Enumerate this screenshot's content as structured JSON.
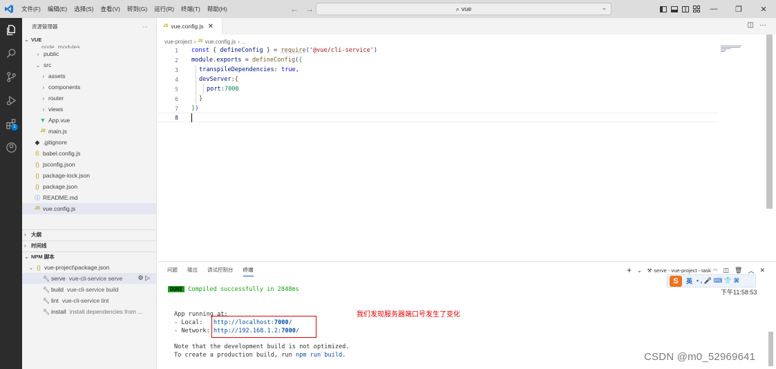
{
  "menu": [
    "文件(F)",
    "编辑(E)",
    "选择(S)",
    "查看(V)",
    "转到(G)",
    "运行(R)",
    "终端(T)",
    "帮助(H)"
  ],
  "command_center": {
    "text": "vue"
  },
  "explorer": {
    "title": "资源管理器",
    "more": "···",
    "root": "VUE",
    "hidden_top": "node_modules",
    "items": [
      {
        "label": "public",
        "icon": "chevron-right"
      },
      {
        "label": "src",
        "icon": "chevron-down"
      },
      {
        "label": "assets",
        "icon": "chevron-right"
      },
      {
        "label": "components",
        "icon": "chevron-right"
      },
      {
        "label": "router",
        "icon": "chevron-right"
      },
      {
        "label": "views",
        "icon": "chevron-right"
      },
      {
        "label": "App.vue",
        "icon": "vue-file"
      },
      {
        "label": "main.js",
        "icon": "js-file"
      },
      {
        "label": ".gitignore",
        "icon": "git-file"
      },
      {
        "label": "babel.config.js",
        "icon": "babel-file"
      },
      {
        "label": "jsconfig.json",
        "icon": "json-file"
      },
      {
        "label": "package-lock.json",
        "icon": "json-file"
      },
      {
        "label": "package.json",
        "icon": "json-file"
      },
      {
        "label": "README.md",
        "icon": "info-file"
      },
      {
        "label": "vue.config.js",
        "icon": "js-file"
      }
    ]
  },
  "sections": {
    "outline": "大纲",
    "timeline": "时间线",
    "npm": "NPM 脚本"
  },
  "npm": {
    "file": "vue-project\\package.json",
    "scripts": [
      {
        "name": "serve",
        "cmd": "vue-cli-service serve"
      },
      {
        "name": "build",
        "cmd": "vue-cli-service build"
      },
      {
        "name": "lint",
        "cmd": "vue-cli-service lint"
      },
      {
        "name": "install",
        "cmd": "install dependencies from ..."
      }
    ]
  },
  "editor": {
    "tab": "vue.config.js",
    "breadcrumb": [
      "vue-project",
      "vue.config.js",
      "..."
    ],
    "line_numbers": [
      "1",
      "2",
      "3",
      "4",
      "5",
      "6",
      "7",
      "8"
    ],
    "code": {
      "l1_kw": "const",
      "l1_a": " { ",
      "l1_var": "defineConfig",
      "l1_b": " } = ",
      "l1_fn": "require",
      "l1_c": "(",
      "l1_str": "'@vue/cli-service'",
      "l1_d": ")",
      "l2_var": "module",
      "l2_a": ".",
      "l2_var2": "exports",
      "l2_b": " = ",
      "l2_fn": "defineConfig",
      "l2_c": "(",
      "l2_d": "{",
      "l3_var": "transpileDependencies",
      "l3_a": ": ",
      "l3_kw": "true",
      "l3_b": ",",
      "l4_var": "devServer",
      "l4_a": ":",
      "l4_b": "{",
      "l5_var": "port",
      "l5_a": ":",
      "l5_num": "7000",
      "l6": "}",
      "l7_a": "}",
      "l7_b": ")"
    }
  },
  "panel": {
    "tabs": [
      "问题",
      "输出",
      "调试控制台",
      "终端"
    ],
    "active_tab": "终端",
    "terminal_label": "serve - vue-project - task",
    "done": "DONE",
    "compiled": "Compiled successfully in 2848ms",
    "running": "App running at:",
    "local_label": "- Local:   ",
    "local_url_a": "http://localhost:",
    "local_port": "7000",
    "local_url_b": "/",
    "network_label": "- Network: ",
    "network_url_a": "http://192.168.1.2:",
    "network_port": "7000",
    "network_url_b": "/",
    "note1": "Note that the development build is not optimized.",
    "note2_a": "To create a production build, run ",
    "note2_cmd": "npm run build",
    "note2_b": ".",
    "timestamp": "下午11:58:53"
  },
  "annotation": "我们发现服务器端口号发生了变化",
  "ime": {
    "lang": "英",
    "glyphs": "• ,  🎤  ⌨  👕  ⌘"
  },
  "watermark": "CSDN @m0_52969641",
  "colors": {
    "activity_bar": "#2c2c2c",
    "annotation_red": "#e00000",
    "done_green": "#13a10e"
  }
}
